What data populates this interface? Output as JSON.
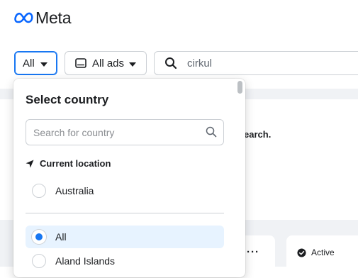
{
  "header": {
    "brand": "Meta",
    "logo_icon": "meta-infinity-logo",
    "brand_color": "#0866ff"
  },
  "filters": {
    "country_button": {
      "label": "All",
      "icon": "caret-down-icon"
    },
    "ad_type_button": {
      "label": "All ads",
      "icon": "tablet-icon"
    },
    "search": {
      "value": "cirkul",
      "icon": "search-icon"
    }
  },
  "background": {
    "search_hint_text": "earch.",
    "card_menu": "···",
    "status_badge": {
      "label": "Active",
      "icon": "check-circle-icon"
    }
  },
  "country_dropdown": {
    "title": "Select country",
    "search_placeholder": "Search for country",
    "current_location_label": "Current location",
    "current_location_option": "Australia",
    "options": [
      {
        "label": "All",
        "selected": true
      },
      {
        "label": "Aland Islands",
        "selected": false
      }
    ],
    "accent_color": "#1877f2"
  }
}
